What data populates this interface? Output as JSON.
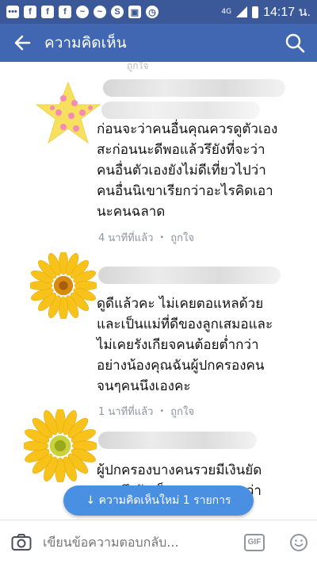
{
  "status": {
    "network": "4G",
    "time": "14:17 น.",
    "icons": [
      "messages-icon",
      "facebook-icon",
      "facebook-icon",
      "facebook-icon",
      "messenger-icon",
      "messenger-icon",
      "s-app-icon",
      "gallery-icon",
      "alarm-icon"
    ]
  },
  "header": {
    "title": "ความคิดเห็น"
  },
  "comments": [
    {
      "text": "ก่อนจะว่าคนอื่นคุณควรดูตัวเอง\nสะก่อนนะดีพอแล้วรึยังที่จะว่า\nคนอื่นตัวเองยังไม่ดีเที่ยวไปว่า\nคนอื่นนิเขาเรียกว่าอะไรคิดเอา\nนะคนฉลาด",
      "time": "4 นาทีที่แล้ว",
      "like": "ถูกใจ"
    },
    {
      "text": "ดูดีแล้วคะ ไม่เคยตอแหลด้วย\nและเป็นแม่ที่ดีของลูกเสมอและ\nไม่เคยรังเกียจคนต้อยต่ำกว่า\nอย่างน้องคุณฉันผู้ปกครองคน\nจนๆคนนึงเองคะ",
      "time": "1 นาทีที่แล้ว",
      "like": "ถูกใจ"
    },
    {
      "text": "ผู้ปกครองบางคนรวยมีเงินยัด\nครอถึงรักเด็กคนรวยมากกว่า",
      "time": "",
      "like": ""
    }
  ],
  "prev_meta": "ถูกใจ",
  "new_comments_pill": "↓ ความคิดเห็นใหม่ 1 รายการ",
  "composer": {
    "placeholder": "เขียนข้อความตอบกลับ...",
    "gif_label": "GIF"
  },
  "colors": {
    "statusbar": "#3b5998",
    "appbar": "#4267b2",
    "pill": "#4a90e2"
  }
}
